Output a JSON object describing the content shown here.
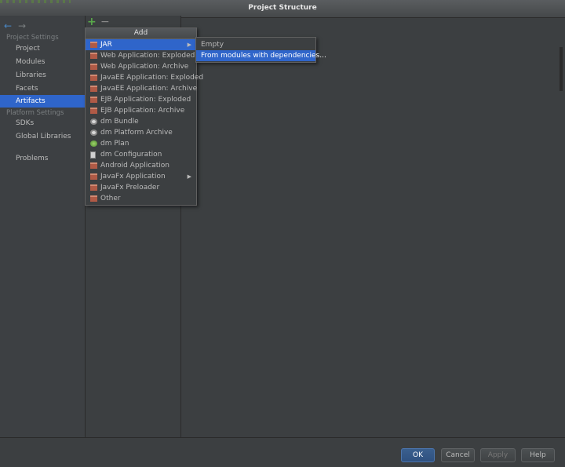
{
  "window": {
    "title": "Project Structure"
  },
  "sidebar": {
    "back_icon": "←",
    "forward_icon": "→",
    "sections": [
      {
        "header": "Project Settings",
        "items": [
          "Project",
          "Modules",
          "Libraries",
          "Facets",
          "Artifacts"
        ]
      },
      {
        "header": "Platform Settings",
        "items": [
          "SDKs",
          "Global Libraries"
        ]
      },
      {
        "header": "",
        "items": [
          "Problems"
        ]
      }
    ],
    "selected": "Artifacts"
  },
  "toolbar": {
    "add_icon": "+",
    "remove_icon": "−"
  },
  "add_menu": {
    "title": "Add",
    "submenu_arrow": "▶",
    "items": [
      {
        "label": "JAR",
        "icon": "jar-icon",
        "submenu": true,
        "selected": true
      },
      {
        "label": "Web Application: Exploded",
        "icon": "jar-icon"
      },
      {
        "label": "Web Application: Archive",
        "icon": "jar-icon"
      },
      {
        "label": "JavaEE Application: Exploded",
        "icon": "jar-icon"
      },
      {
        "label": "JavaEE Application: Archive",
        "icon": "jar-icon"
      },
      {
        "label": "EJB Application: Exploded",
        "icon": "jar-icon"
      },
      {
        "label": "EJB Application: Archive",
        "icon": "jar-icon"
      },
      {
        "label": "dm Bundle",
        "icon": "gear-icon"
      },
      {
        "label": "dm Platform Archive",
        "icon": "gear-icon"
      },
      {
        "label": "dm Plan",
        "icon": "plan-icon"
      },
      {
        "label": "dm Configuration",
        "icon": "document-icon"
      },
      {
        "label": "Android Application",
        "icon": "jar-icon"
      },
      {
        "label": "JavaFx Application",
        "icon": "jar-icon",
        "submenu": true
      },
      {
        "label": "JavaFx Preloader",
        "icon": "jar-icon"
      },
      {
        "label": "Other",
        "icon": "jar-icon"
      }
    ]
  },
  "jar_submenu": {
    "items": [
      {
        "label": "Empty"
      },
      {
        "label": "From modules with dependencies...",
        "selected": true
      }
    ]
  },
  "buttons": {
    "ok": "OK",
    "cancel": "Cancel",
    "apply": "Apply",
    "help": "Help"
  },
  "colors": {
    "selection": "#2f65ca",
    "background": "#3c3f41",
    "add_green": "#59a84a"
  }
}
